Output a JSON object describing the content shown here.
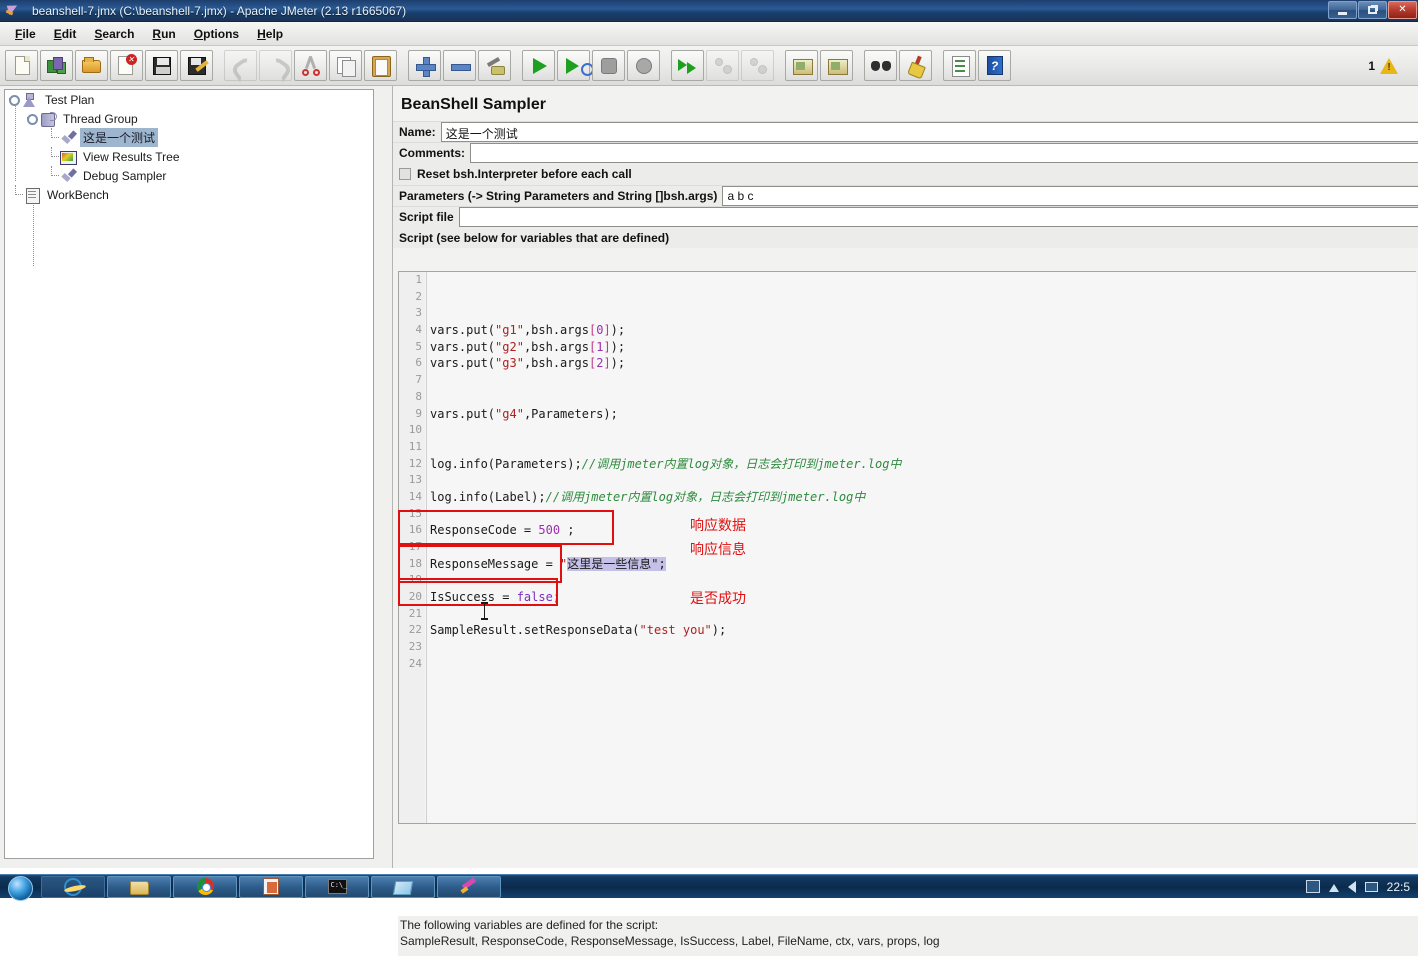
{
  "window": {
    "title": "beanshell-7.jmx (C:\\beanshell-7.jmx) - Apache JMeter (2.13 r1665067)",
    "icon": "jmeter-icon",
    "controls": {
      "minimize": "minimize-button",
      "restore": "restore-button",
      "close": "close-button"
    }
  },
  "menubar": {
    "items": [
      {
        "label": "File",
        "mnemonic": "F"
      },
      {
        "label": "Edit",
        "mnemonic": "E"
      },
      {
        "label": "Search",
        "mnemonic": "S"
      },
      {
        "label": "Run",
        "mnemonic": "R"
      },
      {
        "label": "Options",
        "mnemonic": "O"
      },
      {
        "label": "Help",
        "mnemonic": "H"
      }
    ]
  },
  "toolbar": {
    "groups": [
      [
        "new",
        "templates",
        "open",
        "close",
        "save",
        "save-as"
      ],
      [
        "undo",
        "redo",
        "cut",
        "copy",
        "paste"
      ],
      [
        "expand-all",
        "collapse-all",
        "toggle"
      ],
      [
        "start",
        "start-no-pauses",
        "stop",
        "shutdown"
      ],
      [
        "remote-start-all",
        "remote-stop-all",
        "remote-shutdown-all"
      ],
      [
        "clear",
        "clear-all"
      ],
      [
        "search",
        "search-reset"
      ],
      [
        "function-helper",
        "help"
      ]
    ],
    "warning_count": "1",
    "warning_icon": "warning-triangle-icon"
  },
  "tree": {
    "nodes": [
      {
        "label": "Test Plan",
        "icon": "test-plan-icon",
        "depth": 0,
        "selected": false
      },
      {
        "label": "Thread Group",
        "icon": "thread-group-icon",
        "depth": 1,
        "selected": false
      },
      {
        "label": "这是一个测试",
        "icon": "beanshell-sampler-icon",
        "depth": 2,
        "selected": true
      },
      {
        "label": "View Results Tree",
        "icon": "view-results-tree-icon",
        "depth": 2,
        "selected": false
      },
      {
        "label": "Debug Sampler",
        "icon": "debug-sampler-icon",
        "depth": 2,
        "selected": false
      },
      {
        "label": "WorkBench",
        "icon": "workbench-icon",
        "depth": 0,
        "selected": false
      }
    ]
  },
  "panel": {
    "title": "BeanShell Sampler",
    "name_label": "Name:",
    "name_value": "这是一个测试",
    "comments_label": "Comments:",
    "comments_value": "",
    "reset_checkbox_label": "Reset bsh.Interpreter before each call",
    "reset_checkbox_checked": false,
    "parameters_label": "Parameters (-> String Parameters and String []bsh.args)",
    "parameters_value": "a b c",
    "script_file_label": "Script file",
    "script_file_value": "",
    "script_header": "Script (see below for variables that are defined)"
  },
  "editor": {
    "line_numbers": [
      "1",
      "2",
      "3",
      "4",
      "5",
      "6",
      "7",
      "8",
      "9",
      "10",
      "11",
      "12",
      "13",
      "14",
      "15",
      "16",
      "17",
      "18",
      "19",
      "20",
      "21",
      "22",
      "23",
      "24"
    ],
    "lines": [
      {
        "n": 1,
        "segments": []
      },
      {
        "n": 2,
        "segments": []
      },
      {
        "n": 3,
        "segments": []
      },
      {
        "n": 4,
        "segments": [
          {
            "t": "vars.put(",
            "c": "plain"
          },
          {
            "t": "\"g1\"",
            "c": "str"
          },
          {
            "t": ",bsh.args",
            "c": "plain"
          },
          {
            "t": "[",
            "c": "brk"
          },
          {
            "t": "0",
            "c": "num"
          },
          {
            "t": "]",
            "c": "brk"
          },
          {
            "t": ");",
            "c": "plain"
          }
        ]
      },
      {
        "n": 5,
        "segments": [
          {
            "t": "vars.put(",
            "c": "plain"
          },
          {
            "t": "\"g2\"",
            "c": "str"
          },
          {
            "t": ",bsh.args",
            "c": "plain"
          },
          {
            "t": "[",
            "c": "brk"
          },
          {
            "t": "1",
            "c": "num"
          },
          {
            "t": "]",
            "c": "brk"
          },
          {
            "t": ");",
            "c": "plain"
          }
        ]
      },
      {
        "n": 6,
        "segments": [
          {
            "t": "vars.put(",
            "c": "plain"
          },
          {
            "t": "\"g3\"",
            "c": "str"
          },
          {
            "t": ",bsh.args",
            "c": "plain"
          },
          {
            "t": "[",
            "c": "brk"
          },
          {
            "t": "2",
            "c": "num"
          },
          {
            "t": "]",
            "c": "brk"
          },
          {
            "t": ");",
            "c": "plain"
          }
        ]
      },
      {
        "n": 7,
        "segments": []
      },
      {
        "n": 8,
        "segments": []
      },
      {
        "n": 9,
        "segments": [
          {
            "t": "vars.put(",
            "c": "plain"
          },
          {
            "t": "\"g4\"",
            "c": "str"
          },
          {
            "t": ",Parameters);",
            "c": "plain"
          }
        ]
      },
      {
        "n": 10,
        "segments": []
      },
      {
        "n": 11,
        "segments": []
      },
      {
        "n": 12,
        "segments": [
          {
            "t": "log.info(Parameters);",
            "c": "plain"
          },
          {
            "t": "//调用jmeter内置log对象，日志会打印到jmeter.log中",
            "c": "cmt"
          }
        ]
      },
      {
        "n": 13,
        "segments": []
      },
      {
        "n": 14,
        "segments": [
          {
            "t": "log.info(Label);",
            "c": "plain"
          },
          {
            "t": "//调用jmeter内置log对象，日志会打印到jmeter.log中",
            "c": "cmt"
          }
        ]
      },
      {
        "n": 15,
        "segments": []
      },
      {
        "n": 16,
        "segments": [
          {
            "t": "ResponseCode = ",
            "c": "plain"
          },
          {
            "t": "500",
            "c": "num"
          },
          {
            "t": " ;",
            "c": "plain"
          }
        ]
      },
      {
        "n": 17,
        "segments": []
      },
      {
        "n": 18,
        "segments": [
          {
            "t": "ResponseMessage = ",
            "c": "plain"
          },
          {
            "t": "\"",
            "c": "str"
          },
          {
            "t": "这里是一些信息\";",
            "c": "sel"
          }
        ]
      },
      {
        "n": 19,
        "segments": []
      },
      {
        "n": 20,
        "segments": [
          {
            "t": "IsSuccess = ",
            "c": "plain"
          },
          {
            "t": "false",
            "c": "kw"
          },
          {
            "t": ";",
            "c": "plain"
          }
        ]
      },
      {
        "n": 21,
        "segments": []
      },
      {
        "n": 22,
        "segments": [
          {
            "t": "SampleResult.setResponseData(",
            "c": "plain"
          },
          {
            "t": "\"test you\"",
            "c": "str"
          },
          {
            "t": ");",
            "c": "plain"
          }
        ]
      },
      {
        "n": 23,
        "segments": []
      },
      {
        "n": 24,
        "segments": []
      }
    ],
    "annotations": [
      {
        "text": "响应数据",
        "name": "annotation-response-data"
      },
      {
        "text": "响应信息",
        "name": "annotation-response-message"
      },
      {
        "text": "是否成功",
        "name": "annotation-is-success"
      }
    ],
    "highlight_color": "#e01010",
    "selection_color": "#c5c0e8"
  },
  "footer": {
    "line1": "The following variables are defined for the script:",
    "line2": "SampleResult, ResponseCode, ResponseMessage, IsSuccess, Label, FileName, ctx, vars, props, log"
  },
  "taskbar": {
    "start_label": "start-orb",
    "tasks": [
      {
        "name": "internet-explorer",
        "pinned": true
      },
      {
        "name": "file-explorer",
        "pinned": false
      },
      {
        "name": "google-chrome",
        "pinned": false
      },
      {
        "name": "powerpoint",
        "pinned": false
      },
      {
        "name": "command-prompt",
        "pinned": false
      },
      {
        "name": "window-app",
        "pinned": false
      },
      {
        "name": "apache-jmeter",
        "pinned": false
      }
    ],
    "clock": "22:5"
  }
}
